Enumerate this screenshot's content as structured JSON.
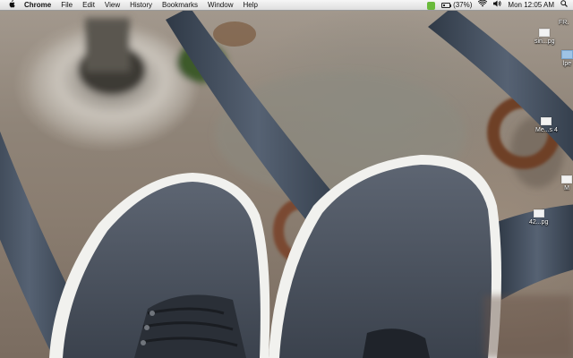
{
  "menubar": {
    "apple_icon": "apple-icon",
    "app_name": "Chrome",
    "menus": [
      "File",
      "Edit",
      "View",
      "History",
      "Bookmarks",
      "Window",
      "Help"
    ],
    "status": {
      "evernote_icon": "evernote-icon",
      "battery_percent_text": "(37%)",
      "battery_level": 0.37,
      "wifi_icon": "wifi-icon",
      "volume_icon": "volume-icon",
      "clock": "Mon 12:05 AM",
      "spotlight_icon": "spotlight-icon"
    }
  },
  "desktop_icons": [
    {
      "label": "FR.",
      "kind": "image"
    },
    {
      "label": "sin...pg",
      "kind": "image"
    },
    {
      "label": "lpe",
      "kind": "folder"
    },
    {
      "label": "Me...s 4",
      "kind": "image"
    },
    {
      "label": "M",
      "kind": "image"
    },
    {
      "label": "42...pg",
      "kind": "image"
    }
  ],
  "colors": {
    "menubar_bg": "#e9e9e9",
    "menubar_text": "#111111",
    "evernote_green": "#6aba3b",
    "shoe_fabric": "#4e5663",
    "shoe_sole": "#f2f2f0",
    "metal_rail": "#3f4a5a",
    "rust": "#7a4a30"
  }
}
